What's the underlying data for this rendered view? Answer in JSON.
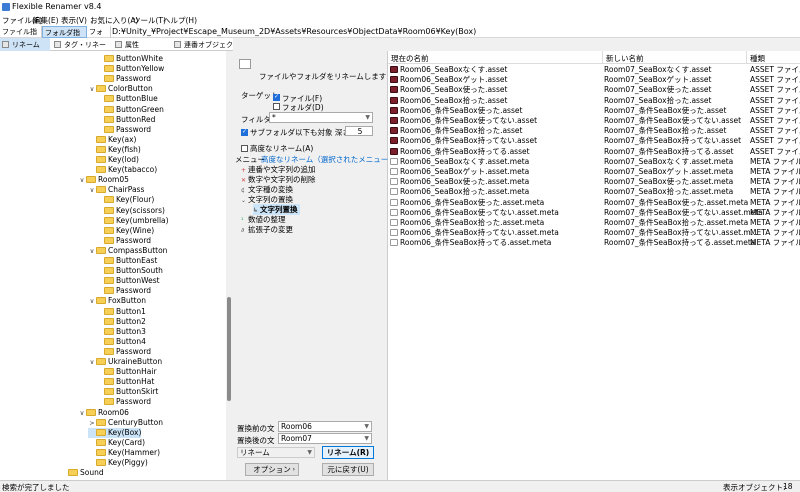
{
  "window": {
    "title": "Flexible Renamer v8.4"
  },
  "menu": [
    "ファイル(F)",
    "編集(E)",
    "表示(V)",
    "お気に入り(A)",
    "ツール(T)",
    "ヘルプ(H)"
  ],
  "pathbar": {
    "tabs": [
      "ファイル指定",
      "フォルダ指定",
      "フォルダ"
    ],
    "path": "D:¥Unity_¥Project¥Escape_Museum_2D¥Assets¥Resources¥ObjectData¥Room06¥Key(Box)"
  },
  "tool_tabs": [
    "リネーム",
    "タグ・リネーム",
    "属性",
    "連番オブジェクト"
  ],
  "tree": [
    {
      "label": "ButtonWhite",
      "depth": 3
    },
    {
      "label": "ButtonYellow",
      "depth": 3
    },
    {
      "label": "Password",
      "depth": 3
    },
    {
      "label": "ColorButton",
      "depth": 2,
      "exp": "∨"
    },
    {
      "label": "ButtonBlue",
      "depth": 3
    },
    {
      "label": "ButtonGreen",
      "depth": 3
    },
    {
      "label": "ButtonRed",
      "depth": 3
    },
    {
      "label": "Password",
      "depth": 3
    },
    {
      "label": "Key(ax)",
      "depth": 2
    },
    {
      "label": "Key(fish)",
      "depth": 2
    },
    {
      "label": "Key(lod)",
      "depth": 2
    },
    {
      "label": "Key(tabacco)",
      "depth": 2
    },
    {
      "label": "Room05",
      "depth": 1,
      "exp": "∨"
    },
    {
      "label": "ChairPass",
      "depth": 2,
      "exp": "∨"
    },
    {
      "label": "Key(Flour)",
      "depth": 3
    },
    {
      "label": "Key(scissors)",
      "depth": 3
    },
    {
      "label": "Key(umbrella)",
      "depth": 3
    },
    {
      "label": "Key(Wine)",
      "depth": 3
    },
    {
      "label": "Password",
      "depth": 3
    },
    {
      "label": "CompassButton",
      "depth": 2,
      "exp": "∨"
    },
    {
      "label": "ButtonEast",
      "depth": 3
    },
    {
      "label": "ButtonSouth",
      "depth": 3
    },
    {
      "label": "ButtonWest",
      "depth": 3
    },
    {
      "label": "Password",
      "depth": 3
    },
    {
      "label": "FoxButton",
      "depth": 2,
      "exp": "∨"
    },
    {
      "label": "Button1",
      "depth": 3
    },
    {
      "label": "Button2",
      "depth": 3
    },
    {
      "label": "Button3",
      "depth": 3
    },
    {
      "label": "Button4",
      "depth": 3
    },
    {
      "label": "Password",
      "depth": 3
    },
    {
      "label": "UkraineButton",
      "depth": 2,
      "exp": "∨"
    },
    {
      "label": "ButtonHair",
      "depth": 3
    },
    {
      "label": "ButtonHat",
      "depth": 3
    },
    {
      "label": "ButtonSkirt",
      "depth": 3
    },
    {
      "label": "Password",
      "depth": 3
    },
    {
      "label": "Room06",
      "depth": 1,
      "exp": "∨"
    },
    {
      "label": "CenturyButton",
      "depth": 2,
      "exp": ">"
    },
    {
      "label": "Key(Box)",
      "depth": 2,
      "selected": true
    },
    {
      "label": "Key(Card)",
      "depth": 2
    },
    {
      "label": "Key(Hammer)",
      "depth": 2
    },
    {
      "label": "Key(Piggy)",
      "depth": 2
    },
    {
      "label": "Sound",
      "depth": 0
    }
  ],
  "mid": {
    "heading": "ファイルやフォルダをリネームします",
    "target_label": "ターゲット",
    "target_file": "ファイル(F)",
    "target_folder": "フォルダ(D)",
    "filter_label": "フィルタ",
    "filter_value": "*",
    "subfolder_label": "サブフォルダ以下も対象 深さ",
    "depth_value": "5",
    "advanced_label": "高度なリネーム(A)",
    "menu_label": "メニュー",
    "menu_link": "高度なリネーム（選択されたメニュー項目）",
    "menu_items": [
      "連番や文字列の追加",
      "数字や文字列の削除",
      "文字種の変換",
      "文字列の置換",
      "文字列置換",
      "数値の整理",
      "拡張子の変更"
    ],
    "before_label": "置換前の文",
    "before_value": "Room06",
    "after_label": "置換後の文",
    "after_value": "Room07",
    "mode_value": "リネーム",
    "rename_button": "リネーム(R)",
    "option_button": "オプション",
    "undo_button": "元に戻す(U)"
  },
  "list": {
    "headers": [
      "現在の名前",
      "新しい名前",
      "種類"
    ],
    "rows": [
      {
        "cur": "Room06_SeaBoxなくす.asset",
        "new": "Room07_SeaBoxなくす.asset",
        "type": "ASSET ファイル",
        "icon": "asset"
      },
      {
        "cur": "Room06_SeaBoxゲット.asset",
        "new": "Room07_SeaBoxゲット.asset",
        "type": "ASSET ファイル",
        "icon": "asset"
      },
      {
        "cur": "Room06_SeaBox使った.asset",
        "new": "Room07_SeaBox使った.asset",
        "type": "ASSET ファイル",
        "icon": "asset"
      },
      {
        "cur": "Room06_SeaBox拾った.asset",
        "new": "Room07_SeaBox拾った.asset",
        "type": "ASSET ファイル",
        "icon": "asset"
      },
      {
        "cur": "Room06_条件SeaBox使った.asset",
        "new": "Room07_条件SeaBox使った.asset",
        "type": "ASSET ファイル",
        "icon": "asset"
      },
      {
        "cur": "Room06_条件SeaBox使ってない.asset",
        "new": "Room07_条件SeaBox使ってない.asset",
        "type": "ASSET ファイル",
        "icon": "asset"
      },
      {
        "cur": "Room06_条件SeaBox拾った.asset",
        "new": "Room07_条件SeaBox拾った.asset",
        "type": "ASSET ファイル",
        "icon": "asset"
      },
      {
        "cur": "Room06_条件SeaBox持ってない.asset",
        "new": "Room07_条件SeaBox持ってない.asset",
        "type": "ASSET ファイル",
        "icon": "asset"
      },
      {
        "cur": "Room06_条件SeaBox持ってる.asset",
        "new": "Room07_条件SeaBox持ってる.asset",
        "type": "ASSET ファイル",
        "icon": "asset"
      },
      {
        "cur": "Room06_SeaBoxなくす.asset.meta",
        "new": "Room07_SeaBoxなくす.asset.meta",
        "type": "META ファイル",
        "icon": "meta"
      },
      {
        "cur": "Room06_SeaBoxゲット.asset.meta",
        "new": "Room07_SeaBoxゲット.asset.meta",
        "type": "META ファイル",
        "icon": "meta"
      },
      {
        "cur": "Room06_SeaBox使った.asset.meta",
        "new": "Room07_SeaBox使った.asset.meta",
        "type": "META ファイル",
        "icon": "meta"
      },
      {
        "cur": "Room06_SeaBox拾った.asset.meta",
        "new": "Room07_SeaBox拾った.asset.meta",
        "type": "META ファイル",
        "icon": "meta"
      },
      {
        "cur": "Room06_条件SeaBox使った.asset.meta",
        "new": "Room07_条件SeaBox使った.asset.meta",
        "type": "META ファイル",
        "icon": "meta"
      },
      {
        "cur": "Room06_条件SeaBox使ってない.asset.meta",
        "new": "Room07_条件SeaBox使ってない.asset.meta",
        "type": "META ファイル",
        "icon": "meta"
      },
      {
        "cur": "Room06_条件SeaBox拾った.asset.meta",
        "new": "Room07_条件SeaBox拾った.asset.meta",
        "type": "META ファイル",
        "icon": "meta"
      },
      {
        "cur": "Room06_条件SeaBox持ってない.asset.meta",
        "new": "Room07_条件SeaBox持ってない.asset.m...",
        "type": "META ファイル",
        "icon": "meta"
      },
      {
        "cur": "Room06_条件SeaBox持ってる.asset.meta",
        "new": "Room07_条件SeaBox持ってる.asset.meta",
        "type": "META ファイル",
        "icon": "meta"
      }
    ]
  },
  "status": {
    "left": "検索が完了しました",
    "objects_label": "表示オブジェクト:",
    "objects_value": "18個"
  }
}
